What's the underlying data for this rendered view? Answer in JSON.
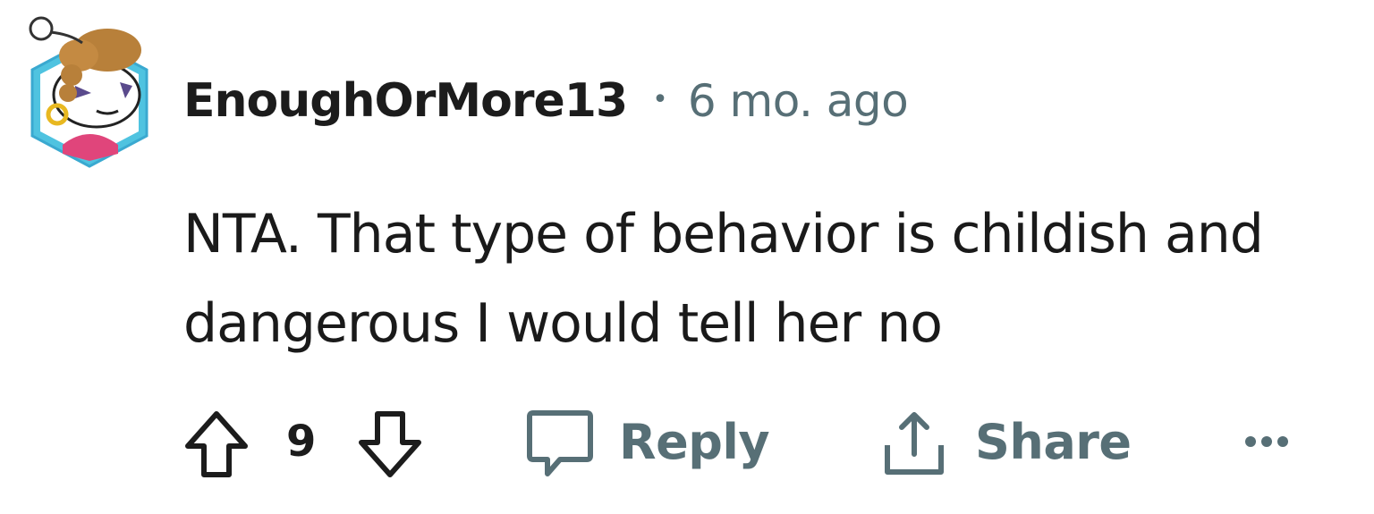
{
  "comment": {
    "username": "EnoughOrMore13",
    "separator": "•",
    "timestamp": "6 mo. ago",
    "body_lines": [
      "NTA. That type of behavior is childish and",
      "dangerous I would tell her no"
    ],
    "score": "9",
    "reply_label": "Reply",
    "share_label": "Share"
  },
  "icons": {
    "avatar": "snoo-avatar-icon",
    "upvote": "upvote-arrow-icon",
    "downvote": "downvote-arrow-icon",
    "reply": "speech-bubble-icon",
    "share": "share-upload-icon",
    "more": "more-options-dots-icon"
  },
  "colors": {
    "username": "#1c1c1c",
    "meta": "#576f76",
    "body": "#1a1a1a",
    "avatar_ring": "#4fc3e0",
    "avatar_shirt": "#e0457b",
    "avatar_hair": "#b8803a"
  }
}
